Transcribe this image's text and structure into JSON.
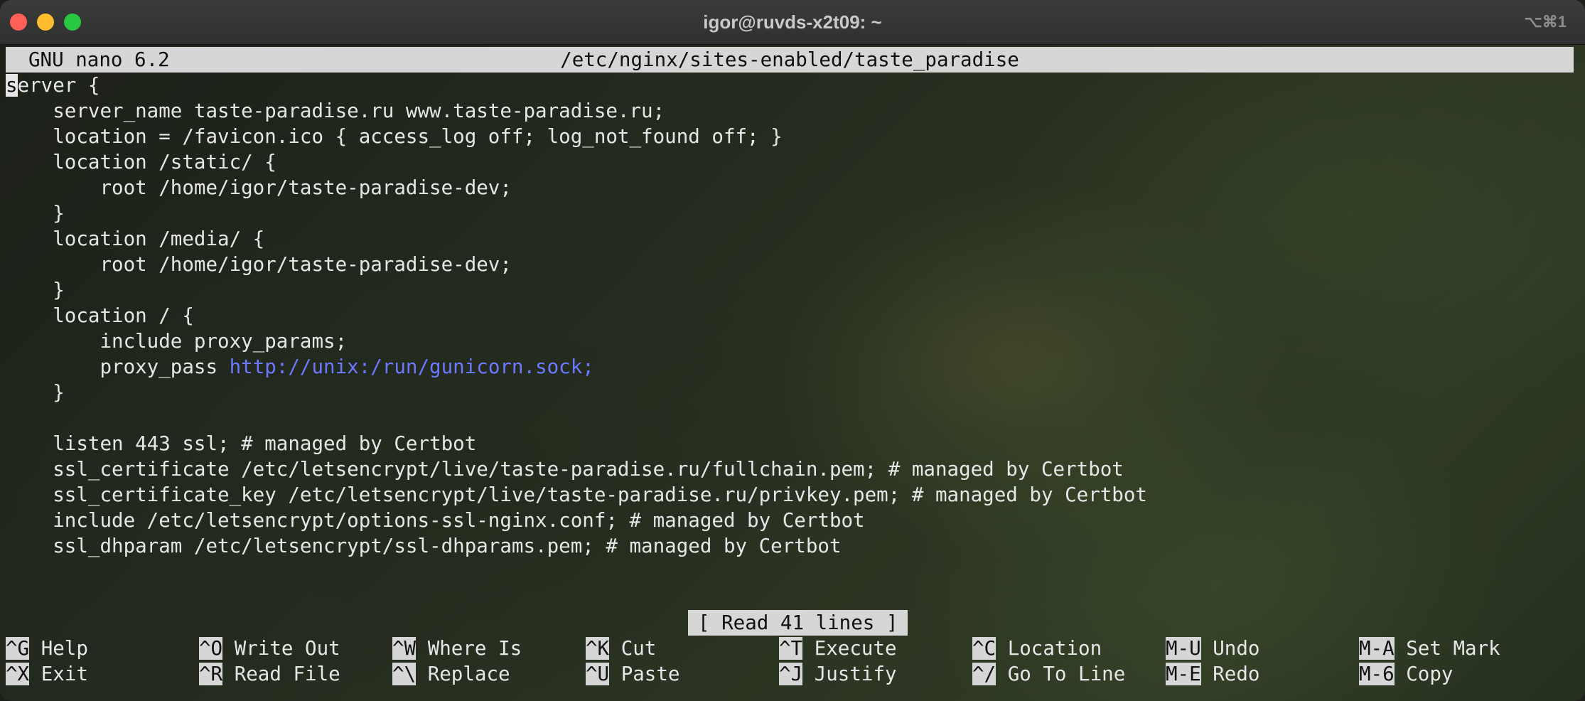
{
  "window": {
    "title": "igor@ruvds-x2t09: ~",
    "shortcut_hint": "⌥⌘1"
  },
  "nano": {
    "app_version": "GNU nano 6.2",
    "file_path": "/etc/nginx/sites-enabled/taste_paradise",
    "cursor_char": "s",
    "lines": [
      "erver {",
      "    server_name taste-paradise.ru www.taste-paradise.ru;",
      "    location = /favicon.ico { access_log off; log_not_found off; }",
      "    location /static/ {",
      "        root /home/igor/taste-paradise-dev;",
      "    }",
      "    location /media/ {",
      "        root /home/igor/taste-paradise-dev;",
      "    }",
      "    location / {",
      "        include proxy_params;",
      "        proxy_pass ",
      "    }",
      "",
      "    listen 443 ssl; # managed by Certbot",
      "    ssl_certificate /etc/letsencrypt/live/taste-paradise.ru/fullchain.pem; # managed by Certbot",
      "    ssl_certificate_key /etc/letsencrypt/live/taste-paradise.ru/privkey.pem; # managed by Certbot",
      "    include /etc/letsencrypt/options-ssl-nginx.conf; # managed by Certbot",
      "    ssl_dhparam /etc/letsencrypt/ssl-dhparams.pem; # managed by Certbot"
    ],
    "proxy_url": "http://unix:/run/gunicorn.sock;",
    "status_message": "[ Read 41 lines ]",
    "shortcuts_row1": [
      {
        "key": "^G",
        "label": "Help"
      },
      {
        "key": "^O",
        "label": "Write Out"
      },
      {
        "key": "^W",
        "label": "Where Is"
      },
      {
        "key": "^K",
        "label": "Cut"
      },
      {
        "key": "^T",
        "label": "Execute"
      },
      {
        "key": "^C",
        "label": "Location"
      },
      {
        "key": "M-U",
        "label": "Undo"
      },
      {
        "key": "M-A",
        "label": "Set Mark"
      }
    ],
    "shortcuts_row2": [
      {
        "key": "^X",
        "label": "Exit"
      },
      {
        "key": "^R",
        "label": "Read File"
      },
      {
        "key": "^\\",
        "label": "Replace"
      },
      {
        "key": "^U",
        "label": "Paste"
      },
      {
        "key": "^J",
        "label": "Justify"
      },
      {
        "key": "^/",
        "label": "Go To Line"
      },
      {
        "key": "M-E",
        "label": "Redo"
      },
      {
        "key": "M-6",
        "label": "Copy"
      }
    ],
    "colors": {
      "header_bg": "#d6d6d6",
      "text": "#e6e6e6",
      "url": "#6c78ff"
    }
  }
}
